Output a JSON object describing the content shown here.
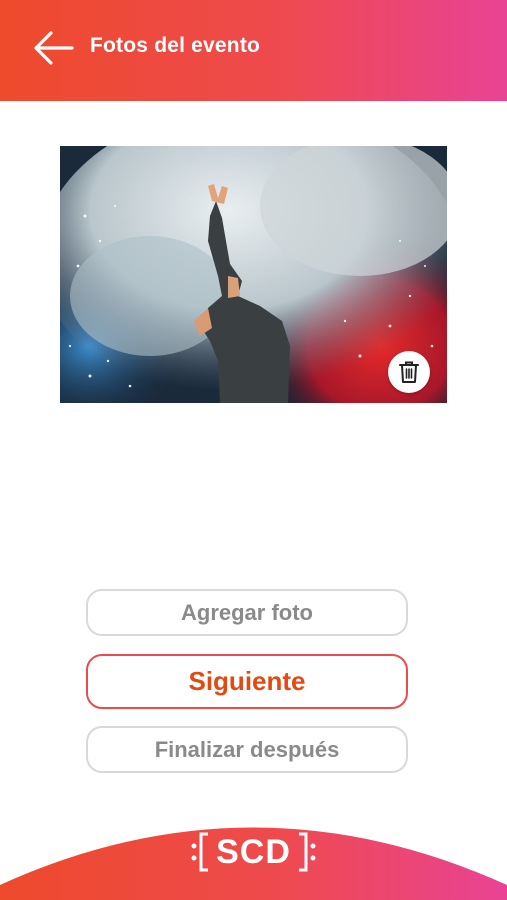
{
  "header": {
    "title": "Fotos del evento",
    "back_icon": "arrow-left-icon",
    "gradient": [
      "#ee4a2c",
      "#e94395"
    ]
  },
  "photo": {
    "delete_icon": "trash-icon"
  },
  "actions": {
    "add_photo_label": "Agregar foto",
    "next_label": "Siguiente",
    "finish_later_label": "Finalizar después"
  },
  "footer": {
    "logo_text": "SCD",
    "accent": "#ee4a4e"
  },
  "colors": {
    "primary_text": "#e24a12",
    "muted_text": "#8a8a8a",
    "border_muted": "#d9d9d9"
  }
}
